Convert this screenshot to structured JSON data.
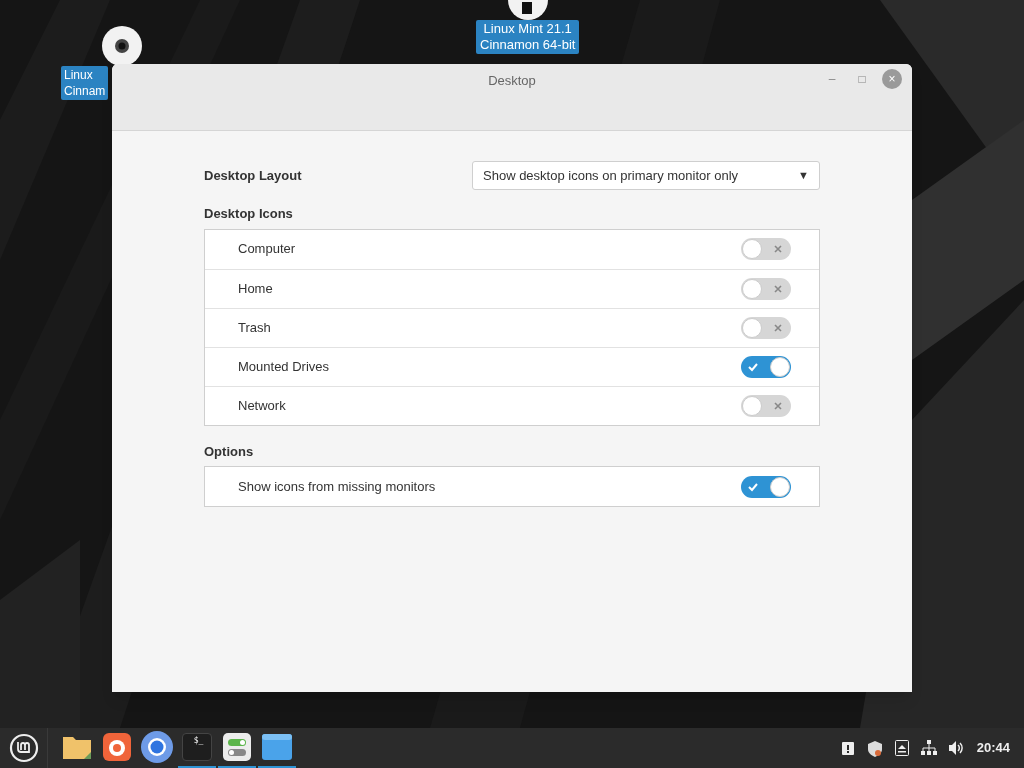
{
  "desktop_icons": [
    {
      "kind": "drive",
      "lines": [
        "Linux Mint 21.1",
        "Cinnamon 64-bit"
      ]
    },
    {
      "kind": "disc",
      "lines": [
        "Linux",
        "Cinnam"
      ]
    }
  ],
  "window": {
    "title": "Desktop",
    "buttons": [
      "–",
      "□",
      "×"
    ]
  },
  "layout": {
    "label": "Desktop Layout",
    "value": "Show desktop icons on primary monitor only",
    "arrow": "▼"
  },
  "icons_section": {
    "heading": "Desktop Icons",
    "items": [
      {
        "label": "Computer",
        "on": false
      },
      {
        "label": "Home",
        "on": false
      },
      {
        "label": "Trash",
        "on": false
      },
      {
        "label": "Mounted Drives",
        "on": true
      },
      {
        "label": "Network",
        "on": false
      }
    ]
  },
  "options_section": {
    "heading": "Options",
    "items": [
      {
        "label": "Show icons from missing monitors",
        "on": true
      }
    ]
  },
  "taskbar": {
    "launchers": [
      {
        "kind": "folder",
        "running": false
      },
      {
        "kind": "firefox",
        "running": false
      },
      {
        "kind": "chromium",
        "running": false
      },
      {
        "kind": "terminal",
        "running": true,
        "text": "$_"
      },
      {
        "kind": "settings",
        "running": true
      },
      {
        "kind": "window",
        "running": true
      }
    ],
    "clock": "20:44"
  }
}
